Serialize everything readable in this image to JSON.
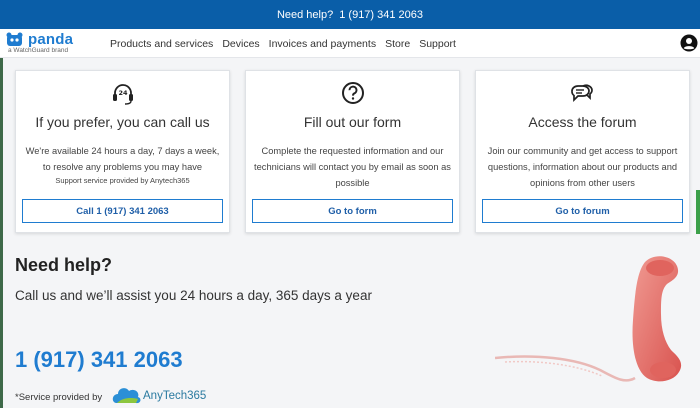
{
  "topbar": {
    "text": "Need help?",
    "phone": "1 (917) 341 2063"
  },
  "logo": {
    "name": "panda",
    "sub": "a WatchGuard brand"
  },
  "nav": {
    "items": [
      "Products and services",
      "Devices",
      "Invoices and payments",
      "Store",
      "Support"
    ]
  },
  "cards": [
    {
      "icon": "headset-24-7-icon",
      "title": "If you prefer, you can call us",
      "desc": "We're available 24 hours a day, 7 days a week, to resolve any problems you may have",
      "note": "Support service provided by Anytech365",
      "button": "Call 1 (917) 341 2063"
    },
    {
      "icon": "question-circle-icon",
      "title": "Fill out our form",
      "desc": "Complete the requested information and our technicians will contact you by email as soon as possible",
      "button": "Go to form"
    },
    {
      "icon": "chat-bubbles-icon",
      "title": "Access the forum",
      "desc": "Join our community and get access to support questions, information about our products and opinions from other users",
      "button": "Go to forum"
    }
  ],
  "help": {
    "title": "Need help?",
    "subtitle": "Call us and we’ll assist you 24 hours a day, 365 days a year",
    "phone": "1 (917) 341 2063",
    "service_label": "*Service provided by",
    "service_brand": "AnyTech365"
  },
  "colors": {
    "topbar": "#0a5ea8",
    "accent": "#1f7cd0",
    "handset": "#e46f6a"
  }
}
